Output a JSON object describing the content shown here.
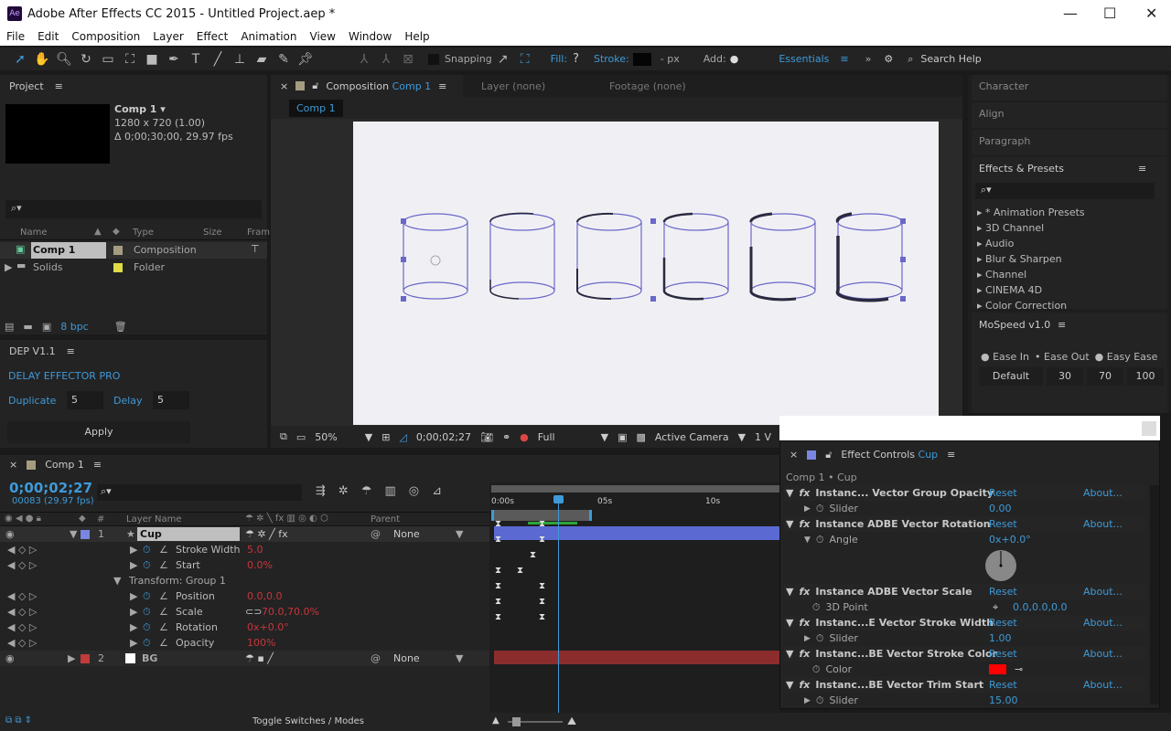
{
  "window": {
    "title": "Adobe After Effects CC 2015 - Untitled Project.aep *",
    "logo": "Ae",
    "minimize": "—",
    "maximize": "☐",
    "close": "✕"
  },
  "menu": [
    "File",
    "Edit",
    "Composition",
    "Layer",
    "Effect",
    "Animation",
    "View",
    "Window",
    "Help"
  ],
  "toolbar": {
    "snapping": "Snapping",
    "fill": "Fill:",
    "fill_value": "?",
    "stroke": "Stroke:",
    "px": "- px",
    "add": "Add:",
    "workspace": "Essentials",
    "more": "»",
    "search_help": "Search Help"
  },
  "project": {
    "title": "Project",
    "comp_name": "Comp 1 ▾",
    "comp_size": "1280 x 720 (1.00)",
    "comp_duration": "Δ 0;00;30;00, 29.97 fps",
    "columns": [
      "Name",
      "Type",
      "Size",
      "Fram"
    ],
    "items": [
      {
        "name": "Comp 1",
        "type": "Composition",
        "color": "#a59c80"
      },
      {
        "name": "Solids",
        "type": "Folder",
        "color": "#e0dc45"
      }
    ],
    "bpc": "8 bpc"
  },
  "dep": {
    "title": "DEP V1.1",
    "heading": "DELAY EFFECTOR PRO",
    "duplicate_label": "Duplicate",
    "duplicate_value": "5",
    "delay_label": "Delay",
    "delay_value": "5",
    "apply": "Apply"
  },
  "comp_panel": {
    "tab_label": "Composition",
    "tab_comp": "Comp 1",
    "layer_tab": "Layer (none)",
    "footage_tab": "Footage (none)",
    "breadcrumb": "Comp 1",
    "zoom": "50%",
    "timecode": "0;00;02;27",
    "resolution": "Full",
    "camera": "Active Camera",
    "views": "1 V"
  },
  "right_panels": {
    "character": "Character",
    "align": "Align",
    "paragraph": "Paragraph",
    "effects_presets": "Effects & Presets",
    "presets": [
      "* Animation Presets",
      "3D Channel",
      "Audio",
      "Blur & Sharpen",
      "Channel",
      "CINEMA 4D",
      "Color Correction"
    ]
  },
  "mospeed": {
    "title": "MoSpeed v1.0",
    "ease_in": "Ease In",
    "ease_out": "Ease Out",
    "easy_ease": "Easy Ease",
    "selected": "Ease Out",
    "buttons": [
      "Default",
      "30",
      "70",
      "100"
    ]
  },
  "timeline": {
    "tab": "Comp 1",
    "timecode": "0;00;02;27",
    "frames": "00083 (29.97 fps)",
    "col_hash": "#",
    "col_layer": "Layer Name",
    "col_parent": "Parent",
    "ruler": [
      "0:00s",
      "05s",
      "10s"
    ],
    "layers": [
      {
        "num": "1",
        "name": "Cup",
        "color": "#7a86e0",
        "parent": "None"
      },
      {
        "num": "2",
        "name": "BG",
        "color": "#c23a3a",
        "parent": "None"
      }
    ],
    "properties": [
      {
        "name": "Stroke Width",
        "value": "5.0"
      },
      {
        "name": "Start",
        "value": "0.0%"
      },
      {
        "name": "Position",
        "value": "0.0,0.0"
      },
      {
        "name": "Scale",
        "value": "70.0,70.0%"
      },
      {
        "name": "Rotation",
        "value": "0x+0.0°"
      },
      {
        "name": "Opacity",
        "value": "100%"
      }
    ],
    "group": "Transform: Group 1",
    "toggle": "Toggle Switches / Modes"
  },
  "effect_controls": {
    "title": "Effect Controls",
    "layer": "Cup",
    "breadcrumb": "Comp 1 • Cup",
    "reset": "Reset",
    "about": "About...",
    "effects": [
      {
        "name": "Instanc... Vector Group Opacity",
        "param": "Slider",
        "value": "0.00"
      },
      {
        "name": "Instance ADBE Vector Rotation",
        "param": "Angle",
        "value": "0x+0.0°"
      },
      {
        "name": "Instance ADBE Vector Scale",
        "param": "3D Point",
        "value": "0.0,0.0,0.0"
      },
      {
        "name": "Instanc...E Vector Stroke Width",
        "param": "Slider",
        "value": "1.00"
      },
      {
        "name": "Instanc...BE Vector Stroke Color",
        "param": "Color",
        "value": "#ff0000"
      },
      {
        "name": "Instanc...BE Vector Trim Start",
        "param": "Slider",
        "value": "15.00"
      }
    ]
  }
}
